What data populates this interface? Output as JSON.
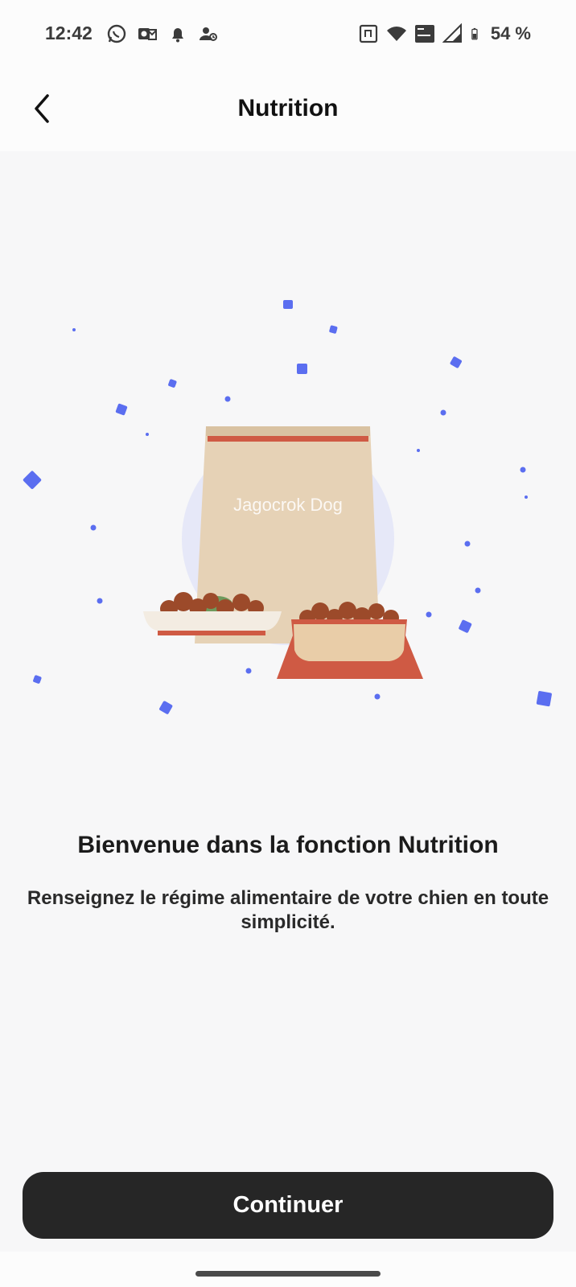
{
  "status_bar": {
    "time": "12:42",
    "left_icons": [
      "whatsapp-icon",
      "outlook-icon",
      "bell-icon",
      "contacts-icon"
    ],
    "right_icons": [
      "nfc-icon",
      "wifi-icon",
      "vowifi-icon",
      "signal-icon",
      "battery-icon"
    ],
    "battery": "54 %"
  },
  "header": {
    "title": "Nutrition",
    "back_icon": "chevron-left-icon"
  },
  "illustration": {
    "bag_label": "Jagocrok Dog",
    "colors": {
      "confetti": "#5b6ef0",
      "halo": "#e6e8f8",
      "bag": "#e6d2b6",
      "bag_stripe": "#cf5a44",
      "kibble": "#9c4a2a",
      "bowl_red": "#cf5a44",
      "bowl_inner": "#e9cda8"
    }
  },
  "content": {
    "welcome_title": "Bienvenue dans la fonction Nutrition",
    "subtitle": "Renseignez le régime alimentaire de votre chien en toute simplicité."
  },
  "footer": {
    "continue_label": "Continuer"
  }
}
